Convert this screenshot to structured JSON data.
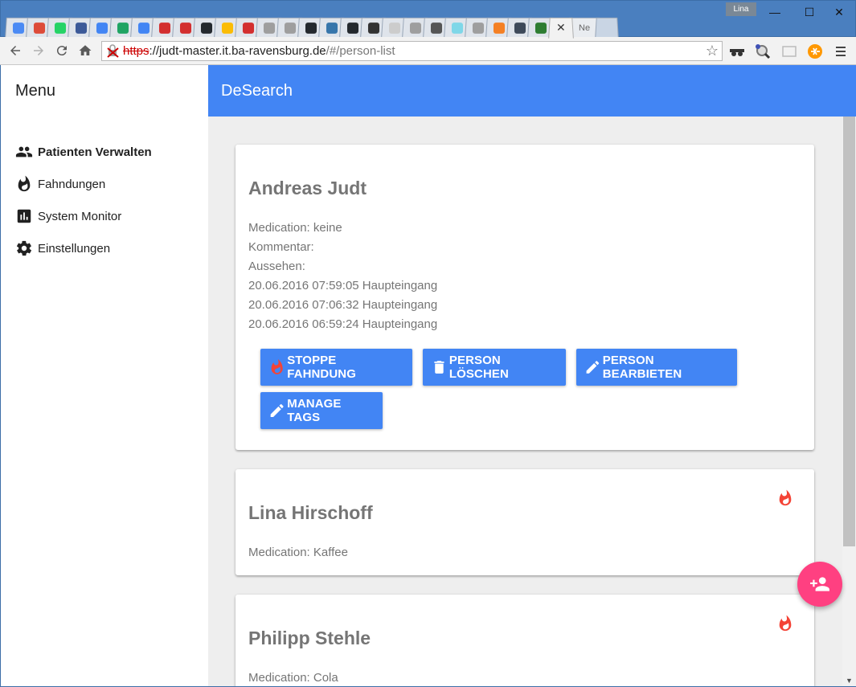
{
  "browser": {
    "profile_name": "Lina",
    "partial_tab_label": "Ne",
    "url_scheme": "https",
    "url_sep": "://",
    "url_host": "judt-master.it.ba-ravensburg.de",
    "url_path": "/#/person-list",
    "tab_favicons": [
      "#4a8af4",
      "#dd4b39",
      "#25d366",
      "#3b5998",
      "#4285f4",
      "#1fa463",
      "#4285f4",
      "#d32f2f",
      "#d32f2f",
      "#24292e",
      "#fbbc05",
      "#d32f2f",
      "#9e9e9e",
      "#9e9e9e",
      "#24292e",
      "#3776ab",
      "#24292e",
      "#333333",
      "#cccccc",
      "#9e9e9e",
      "#555555",
      "#7fd7e8",
      "#9e9e9e",
      "#f48024",
      "#3e4a5a",
      "#2e7d32"
    ]
  },
  "sidebar": {
    "title": "Menu",
    "items": [
      {
        "label": "Patienten Verwalten",
        "icon": "people-icon",
        "active": true
      },
      {
        "label": "Fahndungen",
        "icon": "flame-icon",
        "active": false
      },
      {
        "label": "System Monitor",
        "icon": "chart-icon",
        "active": false
      },
      {
        "label": "Einstellungen",
        "icon": "gear-icon",
        "active": false
      }
    ]
  },
  "appbar": {
    "title": "DeSearch"
  },
  "persons": [
    {
      "name": "Andreas Judt",
      "lines": [
        "Medication: keine",
        "Kommentar:",
        "Aussehen:",
        "20.06.2016 07:59:05 Haupteingang",
        "20.06.2016 07:06:32 Haupteingang",
        "20.06.2016 06:59:24 Haupteingang"
      ],
      "actions": [
        {
          "label": "STOPPE FAHNDUNG",
          "icon": "flame-icon"
        },
        {
          "label": "PERSON LÖSCHEN",
          "icon": "delete-icon"
        },
        {
          "label": "PERSON BEARBIETEN",
          "icon": "edit-icon"
        },
        {
          "label": "MANAGE TAGS",
          "icon": "edit-icon"
        }
      ]
    },
    {
      "name": "Lina Hirschoff",
      "lines": [
        "Medication: Kaffee"
      ],
      "wanted": true
    },
    {
      "name": "Philipp Stehle",
      "lines": [
        "Medication: Cola"
      ],
      "wanted": true
    }
  ],
  "colors": {
    "primary": "#4285f4",
    "fab": "#ff4081",
    "flame": "#f44336"
  },
  "fab_icon": "person-add-icon"
}
